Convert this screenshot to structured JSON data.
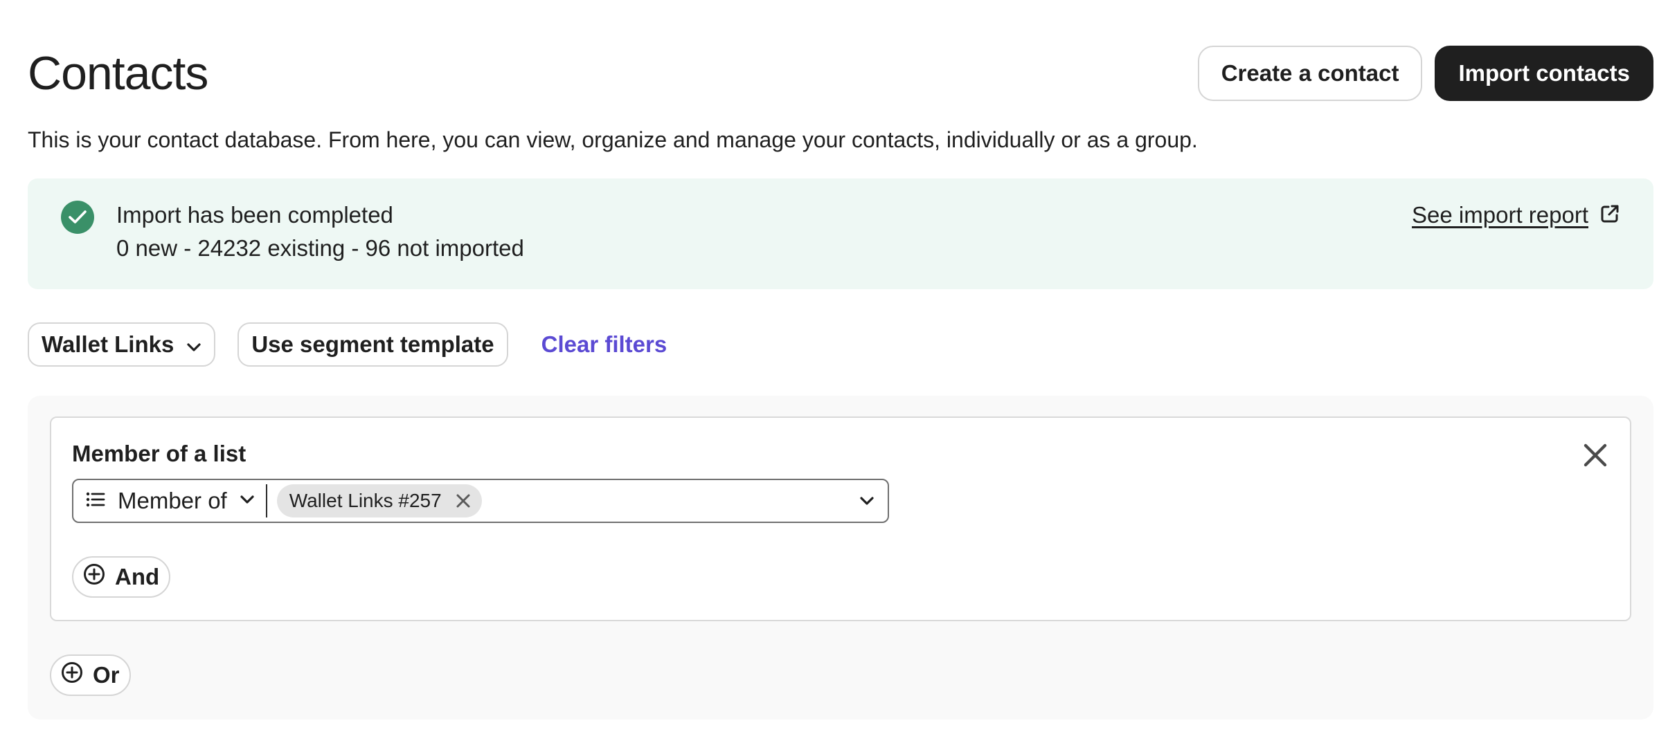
{
  "header": {
    "title": "Contacts",
    "create_label": "Create a contact",
    "import_label": "Import contacts"
  },
  "description": "This is your contact database. From here, you can view, organize and manage your contacts, individually or as a group.",
  "banner": {
    "status_icon": "check-circle-icon",
    "line1": "Import has been completed",
    "line2": "0 new - 24232 existing - 96 not imported",
    "link_label": "See import report",
    "link_icon": "external-link-icon",
    "accent": "#3a9068",
    "background": "#eef8f4"
  },
  "filters": {
    "segment_label": "Wallet Links",
    "template_label": "Use segment template",
    "clear_label": "Clear filters",
    "clear_color": "#5b4ad3"
  },
  "condition": {
    "title": "Member of a list",
    "operator": "Member of",
    "operator_icon": "list-icon",
    "selected_tag": "Wallet Links #257",
    "and_label": "And"
  },
  "or_label": "Or"
}
